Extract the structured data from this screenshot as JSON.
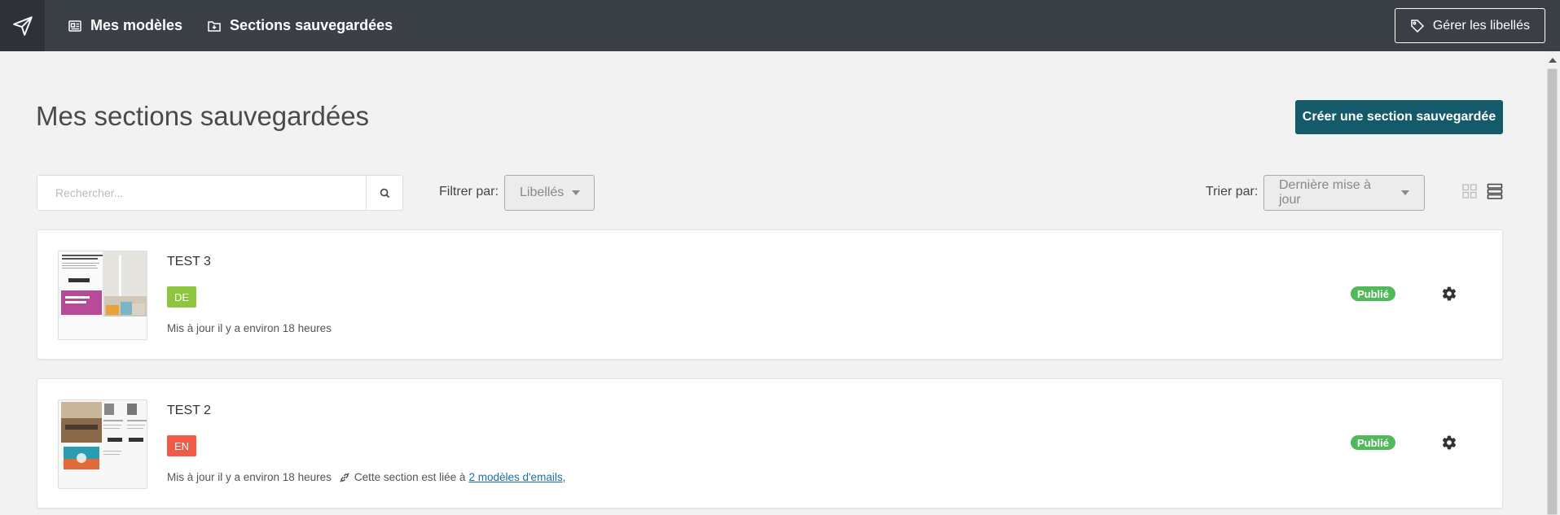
{
  "nav": {
    "my_templates": "Mes modèles",
    "saved_sections": "Sections sauvegardées",
    "manage_labels": "Gérer les libellés"
  },
  "header": {
    "title": "Mes sections sauvegardées",
    "create_button": "Créer une section sauvegardée"
  },
  "filters": {
    "search_placeholder": "Rechercher...",
    "filter_label": "Filtrer par:",
    "filter_value": "Libellés",
    "sort_label": "Trier par:",
    "sort_value": "Dernière mise à jour"
  },
  "sections": [
    {
      "title": "TEST 3",
      "language": "DE",
      "updated": "Mis à jour il y a environ 18 heures",
      "status": "Publié",
      "linked_text": "",
      "linked_link": ""
    },
    {
      "title": "TEST 2",
      "language": "EN",
      "updated": "Mis à jour il y a environ 18 heures",
      "status": "Publié",
      "linked_text": "Cette section est liée à",
      "linked_link": "2 modèles d'emails",
      "linked_suffix": ","
    }
  ],
  "colors": {
    "topbar": "#3b3f46",
    "primary_button": "#155a6a",
    "status_published": "#52b95b",
    "lang_de": "#8cc63f",
    "lang_en": "#f05a47"
  }
}
